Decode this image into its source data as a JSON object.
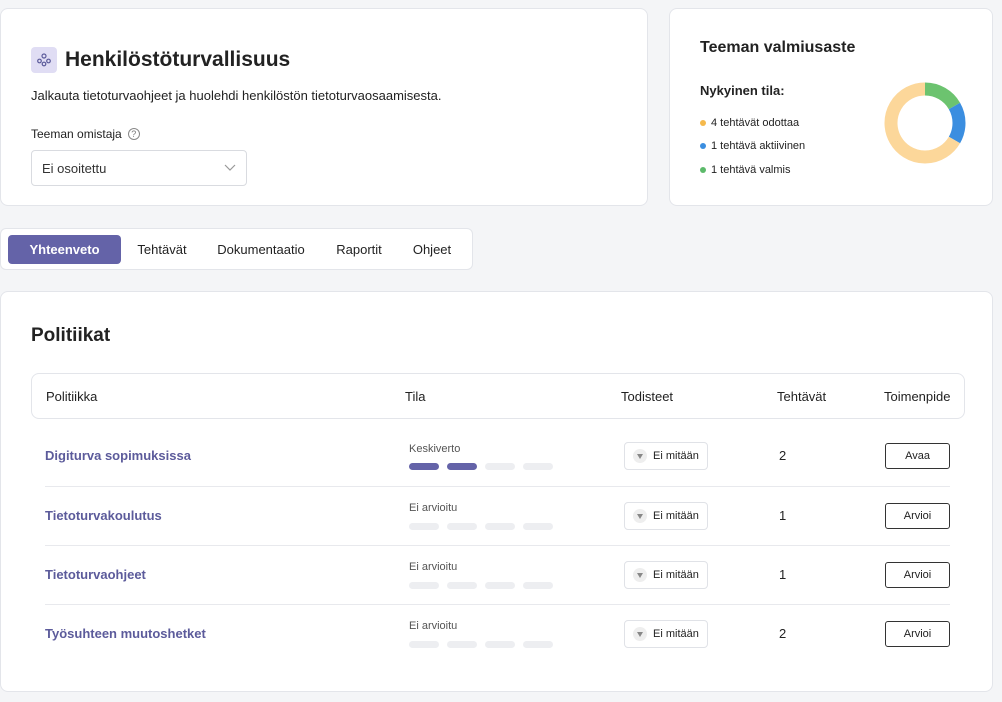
{
  "header": {
    "title": "Henkilöstöturvallisuus",
    "description": "Jalkauta tietoturvaohjeet ja huolehdi henkilöstön tietoturvaosaamisesta.",
    "owner_label": "Teeman omistaja",
    "owner_value": "Ei osoitettu",
    "icon": "people-icon"
  },
  "readiness": {
    "title": "Teeman valmiusaste",
    "subtitle": "Nykyinen tila:",
    "legend": [
      {
        "label": "4 tehtävät odottaa",
        "color": "#f5b94c",
        "count": 4
      },
      {
        "label": "1 tehtävä aktiivinen",
        "color": "#3b8ee0",
        "count": 1
      },
      {
        "label": "1 tehtävä valmis",
        "color": "#5cba6a",
        "count": 1
      }
    ],
    "donut_colors": {
      "pending": "#fcd79a",
      "active": "#3b8ee0",
      "done": "#6cc36f"
    }
  },
  "tabs": [
    {
      "label": "Yhteenveto",
      "active": true
    },
    {
      "label": "Tehtävät",
      "active": false
    },
    {
      "label": "Dokumentaatio",
      "active": false
    },
    {
      "label": "Raportit",
      "active": false
    },
    {
      "label": "Ohjeet",
      "active": false
    }
  ],
  "policies": {
    "title": "Politiikat",
    "columns": [
      "Politiikka",
      "Tila",
      "Todisteet",
      "Tehtävät",
      "Toimenpide"
    ],
    "rows": [
      {
        "name": "Digiturva sopimuksissa",
        "status": "Keskiverto",
        "level": 2,
        "evidence": "Ei mitään",
        "tasks": "2",
        "action": "Avaa"
      },
      {
        "name": "Tietoturvakoulutus",
        "status": "Ei arvioitu",
        "level": 0,
        "evidence": "Ei mitään",
        "tasks": "1",
        "action": "Arvioi"
      },
      {
        "name": "Tietoturvaohjeet",
        "status": "Ei arvioitu",
        "level": 0,
        "evidence": "Ei mitään",
        "tasks": "1",
        "action": "Arvioi"
      },
      {
        "name": "Työsuhteen muutoshetket",
        "status": "Ei arvioitu",
        "level": 0,
        "evidence": "Ei mitään",
        "tasks": "2",
        "action": "Arvioi"
      }
    ]
  }
}
